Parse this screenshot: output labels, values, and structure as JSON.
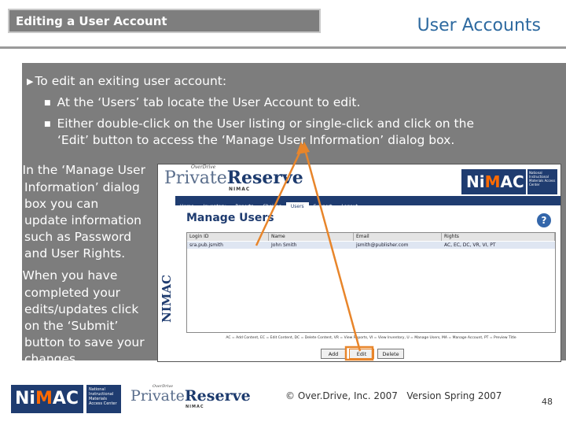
{
  "header": {
    "tag": "Editing a User Account",
    "title": "User Accounts"
  },
  "content": {
    "intro": "To edit an exiting user account:",
    "sub_bullets": [
      "At the ‘Users’ tab locate the User Account to edit.",
      "Either double-click on the User listing or single-click and click on the",
      "‘Edit’ button to access the ‘Manage User Information’ dialog box."
    ],
    "bullets": [
      [
        "In the ‘Manage User",
        "Information’ dialog",
        "box you can",
        "update information",
        "such as Password",
        "and User Rights."
      ],
      [
        "When you have",
        "completed your",
        "edits/updates click",
        "on the ‘Submit’",
        "button to save your",
        "changes."
      ]
    ]
  },
  "screenshot": {
    "brand_over": "OverDrive",
    "brand_a": "Private",
    "brand_b": "Reserve",
    "brand_sub": "NIMAC",
    "nimac_logo": [
      "Ni",
      "M",
      "AC"
    ],
    "nimac_tagline": "National Instructional Materials Access Center",
    "nav": [
      "Home",
      "Inventory",
      "Reports",
      "Choices",
      "Users",
      "Support",
      "Logout"
    ],
    "active_nav": "Users",
    "side_label": "NIMAC",
    "page_title": "Manage Users",
    "help": "?",
    "columns": [
      "Login ID",
      "Name",
      "Email",
      "Rights"
    ],
    "rows": [
      [
        "sra.pub.jsmith",
        "John Smith",
        "jsmith@publisher.com",
        "AC, EC, DC, VR, VI, PT"
      ]
    ],
    "legend": "AC = Add Content, EC = Edit Content, DC = Delete Content, VR = View Reports, VI = View Inventory, U = Manage Users, MA = Manage Account, PT = Preview Title",
    "buttons": [
      "Add",
      "Edit",
      "Delete"
    ]
  },
  "footer": {
    "copyright": "© Over.Drive, Inc. 2007   Version Spring 2007",
    "page": "48"
  },
  "colors": {
    "band": "#7d7d7d",
    "title_blue": "#2e6aa0",
    "arrow": "#e8852a",
    "nimac_navy": "#1f3c70"
  }
}
